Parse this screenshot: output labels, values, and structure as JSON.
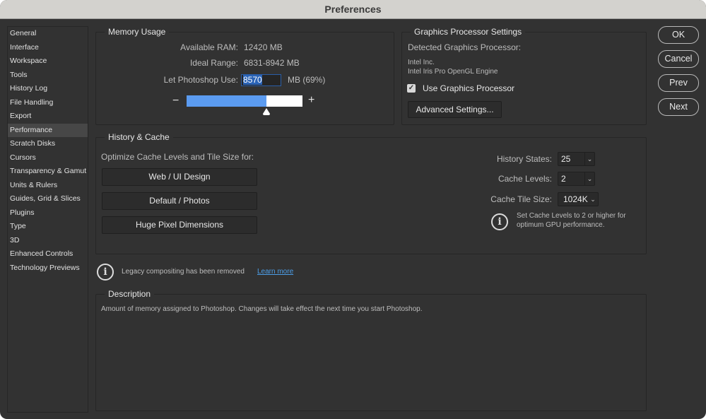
{
  "window": {
    "title": "Preferences"
  },
  "sidebar": {
    "active_index": 7,
    "items": [
      {
        "label": "General"
      },
      {
        "label": "Interface"
      },
      {
        "label": "Workspace"
      },
      {
        "label": "Tools"
      },
      {
        "label": "History Log"
      },
      {
        "label": "File Handling"
      },
      {
        "label": "Export"
      },
      {
        "label": "Performance"
      },
      {
        "label": "Scratch Disks"
      },
      {
        "label": "Cursors"
      },
      {
        "label": "Transparency & Gamut"
      },
      {
        "label": "Units & Rulers"
      },
      {
        "label": "Guides, Grid & Slices"
      },
      {
        "label": "Plugins"
      },
      {
        "label": "Type"
      },
      {
        "label": "3D"
      },
      {
        "label": "Enhanced Controls"
      },
      {
        "label": "Technology Previews"
      }
    ]
  },
  "memory": {
    "title": "Memory Usage",
    "available_label": "Available RAM:",
    "available_value": "12420 MB",
    "ideal_label": "Ideal Range:",
    "ideal_value": "6831-8942 MB",
    "use_label": "Let Photoshop Use:",
    "use_value": "8570",
    "use_unit": "MB (69%)",
    "slider_fraction": 0.69,
    "minus": "−",
    "plus": "+"
  },
  "gpu": {
    "title": "Graphics Processor Settings",
    "detected_label": "Detected Graphics Processor:",
    "vendor": "Intel Inc.",
    "renderer": "Intel Iris Pro OpenGL Engine",
    "use_gpu_label": "Use Graphics Processor",
    "use_gpu_checked": true,
    "advanced_button": "Advanced Settings..."
  },
  "buttons": {
    "ok": "OK",
    "cancel": "Cancel",
    "prev": "Prev",
    "next": "Next"
  },
  "history_cache": {
    "title": "History & Cache",
    "optimize_label": "Optimize Cache Levels and Tile Size for:",
    "presets": [
      "Web / UI Design",
      "Default / Photos",
      "Huge Pixel Dimensions"
    ],
    "history_states_label": "History States:",
    "history_states_value": "25",
    "cache_levels_label": "Cache Levels:",
    "cache_levels_value": "2",
    "cache_tile_label": "Cache Tile Size:",
    "cache_tile_value": "1024K",
    "info_line1": "Set Cache Levels to 2 or higher for",
    "info_line2": "optimum GPU performance."
  },
  "legacy": {
    "text": "Legacy compositing has been removed",
    "link": "Learn more"
  },
  "description": {
    "title": "Description",
    "text": "Amount of memory assigned to Photoshop. Changes will take effect the next time you start Photoshop."
  }
}
